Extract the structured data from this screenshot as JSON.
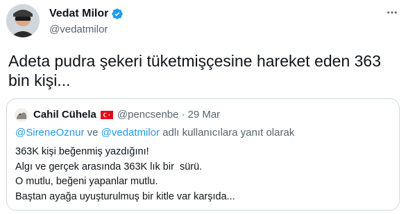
{
  "author": {
    "name": "Vedat Milor",
    "handle": "@vedatmilor",
    "verified_color": "#1d9bf0",
    "icons": [
      "avatar",
      "verified-badge-icon",
      "more-options-icon"
    ]
  },
  "tweet": {
    "text": "Adeta pudra şekeri tüketmişçesine hareket eden 363 bin kişi..."
  },
  "quote": {
    "name": "Cahil Cühela",
    "flag_icon": "turkey-flag-icon",
    "handle": "@pencsenbe",
    "separator": "·",
    "date": "29 Mar",
    "reply": {
      "mention1": "@SireneOznur",
      "connector": " ve ",
      "mention2": "@vedatmilor",
      "suffix": " adlı kullanıcılara yanıt olarak"
    },
    "lines": [
      "363K kişi beğenmiş yazdığını!",
      "Algı ve gerçek arasında 363K lık bir  sürü.",
      "O mutlu, beğeni yapanlar mutlu.",
      "Baştan ayağa uyuşturulmuş bir kitle var karşıda..."
    ]
  },
  "colors": {
    "text": "#0f1419",
    "secondary": "#536471",
    "accent": "#1d9bf0",
    "border": "#cfd9de"
  }
}
